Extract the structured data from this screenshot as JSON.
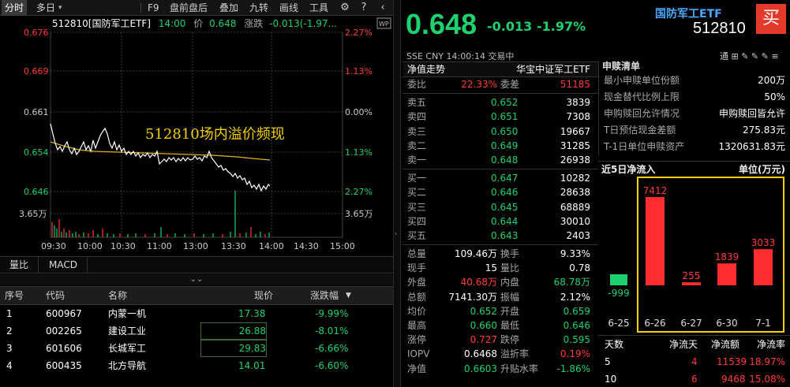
{
  "toolbar": {
    "items": [
      "分时",
      "多日",
      "F9",
      "盘前盘后",
      "叠加",
      "九转",
      "画线",
      "工具"
    ],
    "dropdown_glyph": "▾"
  },
  "chart": {
    "code_name": "512810[国防军工ETF]",
    "time": "14:00",
    "price_label": "价",
    "price": "0.648",
    "chg_label": "涨跌",
    "chg": "-0.013(-1.97...",
    "y_left": [
      "0.676",
      "0.669",
      "0.661",
      "0.654",
      "0.646"
    ],
    "y_right": [
      "2.27%",
      "1.13%",
      "0.00%",
      "1.13%",
      "2.27%"
    ],
    "vol_label": "3.65万",
    "x_labels": [
      "09:30",
      "10:30",
      "11:00",
      "13:00",
      "13:30",
      "14:00",
      "14:30",
      "15:00"
    ],
    "extra_x_label": "10:00",
    "annotation": "512810场内溢价频现",
    "wp_badge": "WP"
  },
  "sub_tabs": [
    "量比",
    "MACD"
  ],
  "collapse_glyph": "⌄⌄",
  "stock_table": {
    "headers": [
      "序号",
      "代码",
      "名称",
      "现价",
      "涨跌幅"
    ],
    "rows": [
      {
        "no": "1",
        "code": "600967",
        "name": "内蒙一机",
        "price": "17.38",
        "chg": "-9.99%"
      },
      {
        "no": "2",
        "code": "002265",
        "name": "建设工业",
        "price": "26.88",
        "chg": "-8.01%"
      },
      {
        "no": "3",
        "code": "601606",
        "name": "长城军工",
        "price": "29.83",
        "chg": "-6.66%"
      },
      {
        "no": "4",
        "code": "600435",
        "name": "北方导航",
        "price": "14.01",
        "chg": "-6.60%"
      },
      {
        "no": "5",
        "code": "",
        "name": "",
        "price": "",
        "chg": ""
      }
    ]
  },
  "quote": {
    "price": "0.648",
    "chg_abs": "-0.013",
    "chg_pct": "-1.97%",
    "fund_name": "国防军工ETF",
    "fund_code": "512810",
    "buy_label": "买",
    "meta": "SSE  CNY  14:00:14  交易中",
    "meta_icons": "通  ⊞  ✎  ✎  ✎  ≡"
  },
  "book": {
    "title": "净值走势",
    "issuer": "华宝中证军工ETF",
    "weibi_label": "委比",
    "weibi": "22.33%",
    "weicha_label": "委差",
    "weicha": "51185",
    "asks": [
      {
        "label": "卖五",
        "price": "0.652",
        "vol": "3839"
      },
      {
        "label": "卖四",
        "price": "0.651",
        "vol": "7308"
      },
      {
        "label": "卖三",
        "price": "0.650",
        "vol": "19667"
      },
      {
        "label": "卖二",
        "price": "0.649",
        "vol": "31285"
      },
      {
        "label": "卖一",
        "price": "0.648",
        "vol": "26938"
      }
    ],
    "bids": [
      {
        "label": "买一",
        "price": "0.647",
        "vol": "10282"
      },
      {
        "label": "买二",
        "price": "0.646",
        "vol": "28638"
      },
      {
        "label": "买三",
        "price": "0.645",
        "vol": "68889"
      },
      {
        "label": "买四",
        "price": "0.644",
        "vol": "30010"
      },
      {
        "label": "买五",
        "price": "0.643",
        "vol": "2403"
      }
    ],
    "stats": [
      {
        "l1": "总量",
        "v1": "109.46万",
        "c1": "white",
        "l2": "换手",
        "v2": "9.33%",
        "c2": "white"
      },
      {
        "l1": "现手",
        "v1": "15",
        "c1": "white",
        "l2": "量比",
        "v2": "0.78",
        "c2": "white"
      },
      {
        "l1": "外盘",
        "v1": "40.68万",
        "c1": "red",
        "l2": "内盘",
        "v2": "68.78万",
        "c2": "green"
      },
      {
        "l1": "总额",
        "v1": "7141.30万",
        "c1": "white",
        "l2": "振幅",
        "v2": "2.12%",
        "c2": "white"
      },
      {
        "l1": "均价",
        "v1": "0.652",
        "c1": "green",
        "l2": "开盘",
        "v2": "0.659",
        "c2": "green"
      },
      {
        "l1": "最高",
        "v1": "0.660",
        "c1": "green",
        "l2": "最低",
        "v2": "0.646",
        "c2": "green"
      },
      {
        "l1": "涨停",
        "v1": "0.727",
        "c1": "red",
        "l2": "跌停",
        "v2": "0.595",
        "c2": "green"
      },
      {
        "l1": "IOPV",
        "v1": "0.6468",
        "c1": "white",
        "l2": "溢折率",
        "v2": "0.19%",
        "c2": "red"
      },
      {
        "l1": "净值",
        "v1": "0.6603",
        "c1": "green",
        "l2": "升贴水率",
        "v2": "-1.86%",
        "c2": "green"
      }
    ]
  },
  "info": {
    "title": "申赎清单",
    "rows": [
      {
        "label": "最小申赎单位份额",
        "value": "200万"
      },
      {
        "label": "现金替代比例上限",
        "value": "50%"
      },
      {
        "label": "申购赎回允许情况",
        "value": "申购赎回皆允许"
      },
      {
        "label": "T日预估现金差额",
        "value": "275.83元"
      },
      {
        "label": "T-1日单位申赎资产",
        "value": "1320631.83元"
      }
    ]
  },
  "flow": {
    "title": "近5日净流入",
    "unit": "单位(万元)",
    "colors": {
      "positive": "#ff2d2d",
      "negative": "#1fd06e",
      "highlight": "#f2d000"
    }
  },
  "chart_data": {
    "type": "bar",
    "title": "近5日净流入",
    "ylabel": "单位(万元)",
    "categories": [
      "6-25",
      "6-26",
      "6-27",
      "6-30",
      "7-1"
    ],
    "values": [
      -999,
      7412,
      255,
      1839,
      3033
    ],
    "value_labels": [
      "-999",
      "7412",
      "255",
      "1839",
      "3033"
    ]
  },
  "days_table": {
    "headers": [
      "天数",
      "净流天",
      "净流额",
      "净流率"
    ],
    "rows": [
      {
        "days": "5",
        "net_days": "4",
        "amount": "11539",
        "rate": "18.97%"
      },
      {
        "days": "10",
        "net_days": "6",
        "amount": "9468",
        "rate": "15.08%"
      }
    ]
  }
}
